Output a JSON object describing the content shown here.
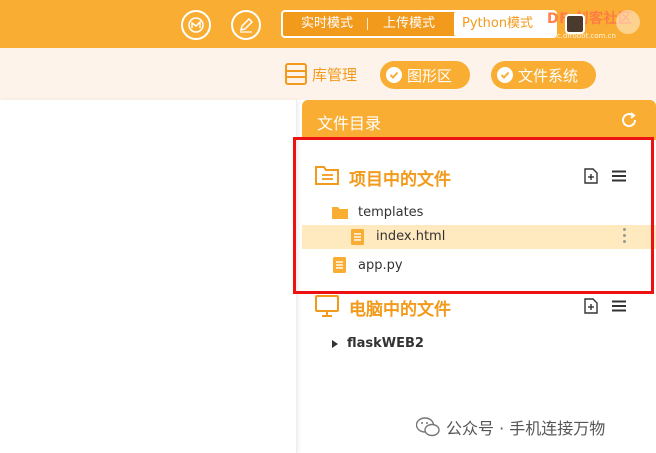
{
  "topbar": {
    "icons": [
      "statistics-icon",
      "edit-icon"
    ],
    "modes": {
      "realtime": "实时模式",
      "upload": "上传模式",
      "python": "Python模式"
    },
    "brand": {
      "name": "DF 创客社区",
      "url": "mc.dfrobot.com.cn"
    }
  },
  "toolbar": {
    "library": "库管理",
    "graphics": "图形区",
    "filesystem": "文件系统"
  },
  "panel": {
    "title": "文件目录",
    "project_section": {
      "title": "项目中的文件",
      "items": [
        {
          "label": "templates",
          "type": "folder"
        },
        {
          "label": "index.html",
          "type": "file"
        },
        {
          "label": "app.py",
          "type": "file"
        }
      ]
    },
    "computer_section": {
      "title": "电脑中的文件",
      "items": [
        {
          "label": "flaskWEB2",
          "type": "folder-collapsed"
        }
      ]
    }
  },
  "colors": {
    "accent": "#f9ae33",
    "accent_dark": "#f29a1c",
    "selected_row": "#ffe9bf",
    "highlight": "#ee1111"
  },
  "watermark": "公众号 · 手机连接万物"
}
